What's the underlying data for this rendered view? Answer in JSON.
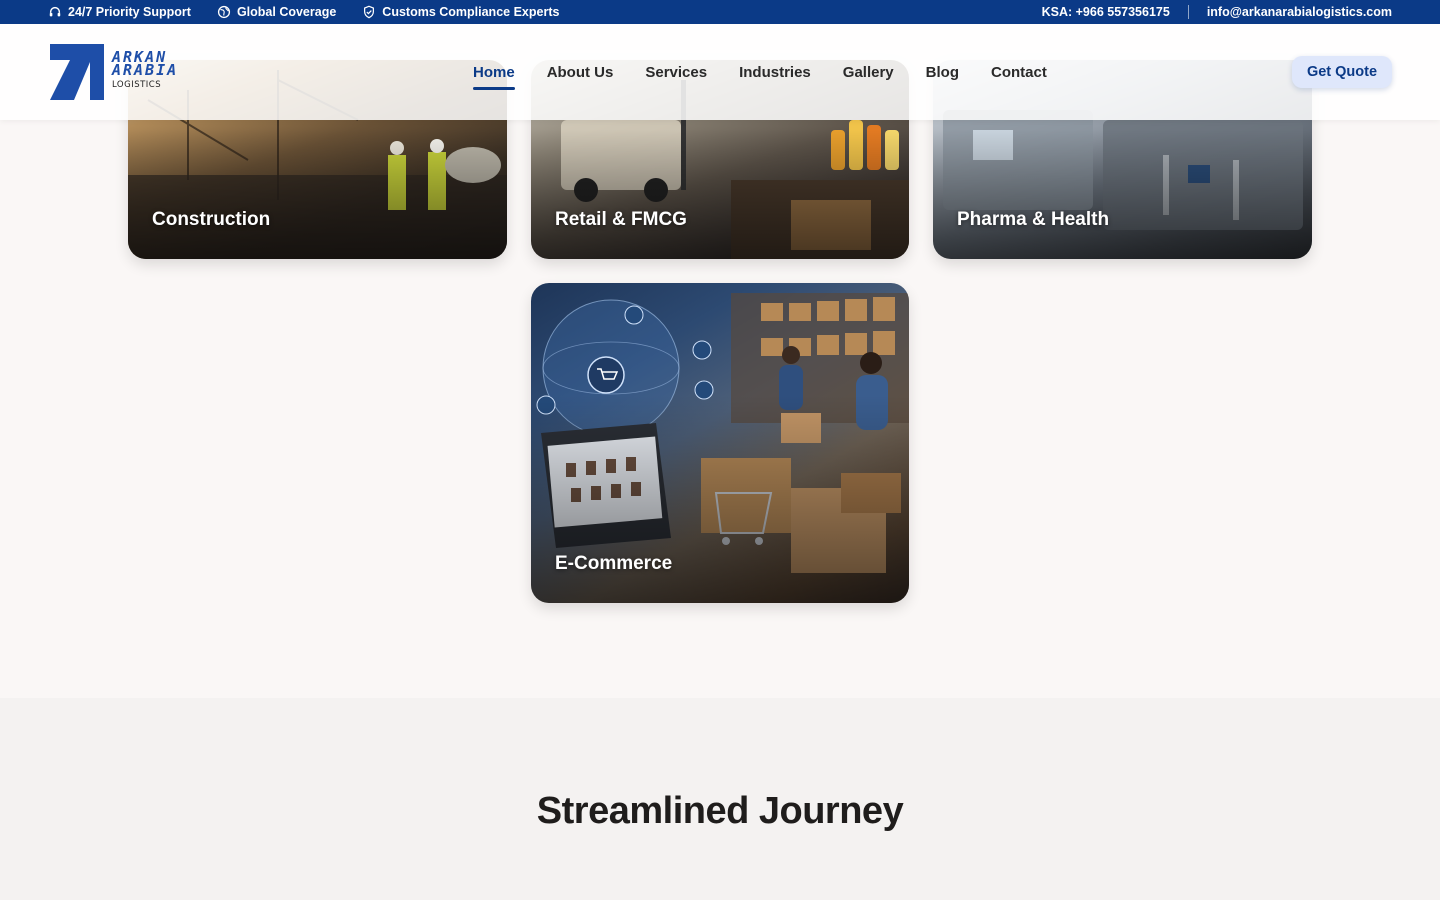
{
  "topbar": {
    "support": "24/7 Priority Support",
    "coverage": "Global Coverage",
    "compliance": "Customs Compliance Experts",
    "phone": "KSA: +966 557356175",
    "email": "info@arkanarabialogistics.com"
  },
  "logo": {
    "line1": "ARKAN",
    "line2": "ARABIA",
    "sub": "LOGISTICS"
  },
  "nav": {
    "items": [
      {
        "label": "Home",
        "active": true
      },
      {
        "label": "About Us"
      },
      {
        "label": "Services"
      },
      {
        "label": "Industries"
      },
      {
        "label": "Gallery"
      },
      {
        "label": "Blog"
      },
      {
        "label": "Contact"
      }
    ],
    "cta": "Get Quote"
  },
  "industries": {
    "cards": [
      {
        "label": "Construction",
        "icon": "construction-photo"
      },
      {
        "label": "Retail & FMCG",
        "icon": "warehouse-photo"
      },
      {
        "label": "Pharma & Health",
        "icon": "pharma-machinery-photo"
      },
      {
        "label": "E-Commerce",
        "icon": "ecommerce-photo"
      }
    ]
  },
  "journey": {
    "title": "Streamlined Journey"
  },
  "colors": {
    "primary": "#0b3a87",
    "logo_blue": "#1e4ea8",
    "cta_bg": "#dfe7fb",
    "page_bg": "#faf7f6"
  }
}
